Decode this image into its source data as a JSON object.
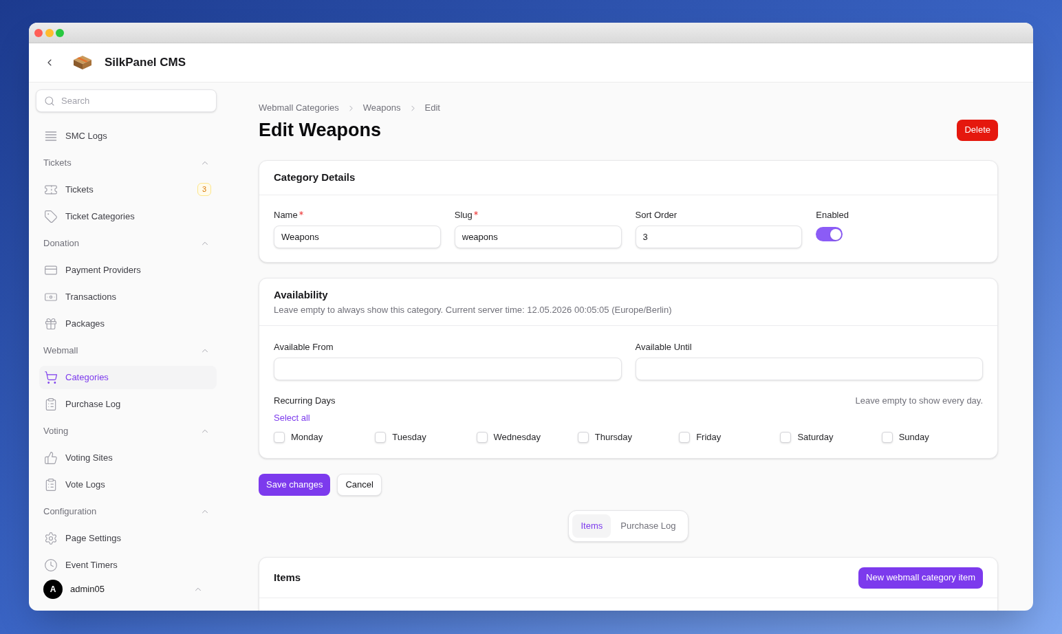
{
  "header": {
    "app_name": "SilkPanel CMS"
  },
  "sidebar": {
    "search": {
      "placeholder": "Search"
    },
    "sections": [
      {
        "items": [
          {
            "label": "SMC Logs",
            "selected": false
          }
        ]
      },
      {
        "title": "Tickets",
        "expanded": true,
        "items": [
          {
            "label": "Tickets",
            "badge": "3",
            "selected": false
          },
          {
            "label": "Ticket Categories",
            "selected": false
          }
        ]
      },
      {
        "title": "Donation",
        "expanded": true,
        "items": [
          {
            "label": "Payment Providers",
            "selected": false
          },
          {
            "label": "Transactions",
            "selected": false
          },
          {
            "label": "Packages",
            "selected": false
          }
        ]
      },
      {
        "title": "Webmall",
        "expanded": true,
        "items": [
          {
            "label": "Categories",
            "selected": true
          },
          {
            "label": "Purchase Log",
            "selected": false
          }
        ]
      },
      {
        "title": "Voting",
        "expanded": true,
        "items": [
          {
            "label": "Voting Sites",
            "selected": false
          },
          {
            "label": "Vote Logs",
            "selected": false
          }
        ]
      },
      {
        "title": "Configuration",
        "expanded": true,
        "items": [
          {
            "label": "Page Settings",
            "selected": false
          },
          {
            "label": "Event Timers",
            "selected": false
          }
        ]
      }
    ],
    "user": {
      "initial": "A",
      "name": "admin05"
    }
  },
  "breadcrumbs": [
    "Webmall Categories",
    "Weapons",
    "Edit"
  ],
  "title": "Edit Weapons",
  "delete_button": "Delete",
  "category_details": {
    "title": "Category Details",
    "fields": [
      {
        "kind": "text",
        "label": "Name",
        "required": true,
        "value": "Weapons"
      },
      {
        "kind": "text",
        "label": "Slug",
        "required": true,
        "value": "weapons"
      },
      {
        "kind": "text",
        "label": "Sort Order",
        "required": false,
        "value": "3"
      },
      {
        "kind": "toggle",
        "label": "Enabled",
        "required": false,
        "on": true
      }
    ]
  },
  "availability": {
    "title": "Availability",
    "description": "Leave empty to always show this category. Current server time: 12.05.2026 00:05:05 (Europe/Berlin)",
    "fields": [
      {
        "label": "Available From"
      },
      {
        "label": "Available Until"
      }
    ],
    "recurring_days": {
      "label": "Recurring Days",
      "hint": "Leave empty to show every day.",
      "select_all": "Select all",
      "days": [
        {
          "label": "Monday",
          "checked": false
        },
        {
          "label": "Tuesday",
          "checked": false
        },
        {
          "label": "Wednesday",
          "checked": false
        },
        {
          "label": "Thursday",
          "checked": false
        },
        {
          "label": "Friday",
          "checked": false
        },
        {
          "label": "Saturday",
          "checked": false
        },
        {
          "label": "Sunday",
          "checked": false
        }
      ]
    }
  },
  "actions": [
    {
      "kind": "primary",
      "label": "Save changes"
    },
    {
      "kind": "secondary",
      "label": "Cancel"
    }
  ],
  "tabs": [
    {
      "label": "Items",
      "selected": true
    },
    {
      "label": "Purchase Log",
      "selected": false
    }
  ],
  "items_panel": {
    "title": "Items",
    "new_button": "New webmall category item"
  }
}
